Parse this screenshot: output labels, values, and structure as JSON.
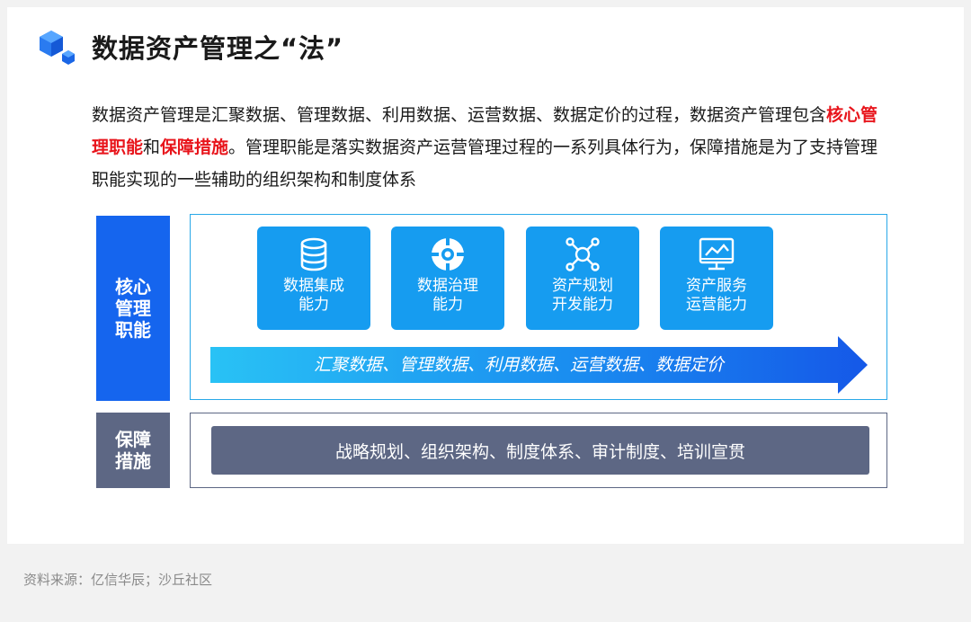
{
  "title": "数据资产管理之“法”",
  "intro": {
    "part1": "数据资产管理是汇聚数据、管理数据、利用数据、运营数据、数据定价的过程，数据资产管理包含",
    "highlight1": "核心管理职能",
    "connector": "和",
    "highlight2": "保障措施",
    "part2": "。管理职能是落实数据资产运营管理过程的一系列具体行为，保障措施是为了支持管理职能实现的一些辅助的组织架构和制度体系"
  },
  "core": {
    "label": "核心管理职能",
    "tiles": [
      {
        "icon": "database-icon",
        "line1": "数据集成",
        "line2": "能力"
      },
      {
        "icon": "governance-target-icon",
        "line1": "数据治理",
        "line2": "能力"
      },
      {
        "icon": "network-nodes-icon",
        "line1": "资产规划",
        "line2": "开发能力"
      },
      {
        "icon": "monitor-chart-icon",
        "line1": "资产服务",
        "line2": "运营能力"
      }
    ],
    "arrow_text": "汇聚数据、管理数据、利用数据、运营数据、数据定价"
  },
  "guard": {
    "label": "保障措施",
    "bar_text": "战略规划、组织架构、制度体系、审计制度、培训宣贯"
  },
  "source": "资料来源：亿信华辰；沙丘社区",
  "colors": {
    "core_blue": "#1565ee",
    "tile_blue": "#169cf0",
    "frame_cyan": "#29a8e8",
    "guard_gray": "#5d6784",
    "highlight_red": "#e8141b"
  }
}
